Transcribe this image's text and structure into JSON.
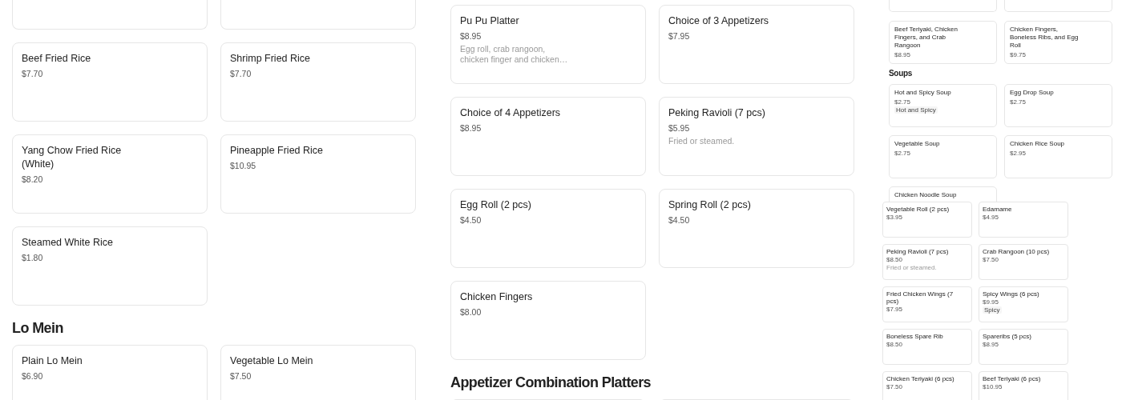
{
  "panels": [
    {
      "sections": [
        {
          "continues_above": true,
          "items": [
            {
              "name": "Beef Fried Rice",
              "price": "$7.70"
            },
            {
              "name": "Shrimp Fried Rice",
              "price": "$7.70"
            },
            {
              "name": "Yang Chow Fried Rice (White)",
              "price": "$8.20"
            },
            {
              "name": "Pineapple Fried Rice",
              "price": "$10.95"
            },
            {
              "name": "Steamed White Rice",
              "price": "$1.80"
            }
          ]
        },
        {
          "heading": "Lo Mein",
          "items": [
            {
              "name": "Plain Lo Mein",
              "price": "$6.90"
            },
            {
              "name": "Vegetable Lo Mein",
              "price": "$7.50"
            }
          ]
        }
      ]
    },
    {
      "sections": [
        {
          "items": [
            {
              "name": "Pu Pu Platter",
              "price": "$8.95",
              "description": "Egg roll, crab rangoon, chicken finger and chicken…"
            },
            {
              "name": "Choice of 3 Appetizers",
              "price": "$7.95"
            },
            {
              "name": "Choice of 4 Appetizers",
              "price": "$8.95"
            },
            {
              "name": "Peking Ravioli (7 pcs)",
              "price": "$5.95",
              "description": "Fried or steamed."
            },
            {
              "name": "Egg Roll (2 pcs)",
              "price": "$4.50"
            },
            {
              "name": "Spring Roll (2 pcs)",
              "price": "$4.50"
            },
            {
              "name": "Chicken Fingers",
              "price": "$8.00"
            }
          ]
        },
        {
          "heading": "Appetizer Combination Platters",
          "continues_below": true
        }
      ]
    },
    {
      "sections": [
        {
          "continues_above": true,
          "items": [
            {
              "name": "Beef Teriyaki, Chicken Fingers, and Crab Rangoon",
              "price": "$8.95"
            },
            {
              "name": "Chicken Fingers, Boneless Ribs, and Egg Roll",
              "price": "$9.75"
            }
          ]
        },
        {
          "heading": "Soups",
          "items": [
            {
              "name": "Hot and Spicy Soup",
              "price": "$2.75",
              "tag": "Hot and Spicy"
            },
            {
              "name": "Egg Drop Soup",
              "price": "$2.75"
            },
            {
              "name": "Vegetable Soup",
              "price": "$2.75"
            },
            {
              "name": "Chicken Rice Soup",
              "price": "$2.95"
            },
            {
              "name": "Chicken Noodle Soup"
            }
          ]
        }
      ]
    },
    {
      "sections": [
        {
          "items": [
            {
              "name": "Vegetable Roll (2 pcs)",
              "price": "$3.95"
            },
            {
              "name": "Edamame",
              "price": "$4.95"
            },
            {
              "name": "Peking Ravioli (7 pcs)",
              "price": "$8.50",
              "description": "Fried or steamed."
            },
            {
              "name": "Crab Rangoon (10 pcs)",
              "price": "$7.50"
            },
            {
              "name": "Fried Chicken Wings (7 pcs)",
              "price": "$7.95"
            },
            {
              "name": "Spicy Wings (6 pcs)",
              "price": "$9.95",
              "tag": "Spicy"
            },
            {
              "name": "Boneless Spare Rib",
              "price": "$8.50"
            },
            {
              "name": "Spareribs (5 pcs)",
              "price": "$8.95"
            },
            {
              "name": "Chicken Teriyaki (6 pcs)",
              "price": "$7.50"
            },
            {
              "name": "Beef Teriyaki (6 pcs)",
              "price": "$10.95"
            }
          ]
        }
      ]
    }
  ]
}
